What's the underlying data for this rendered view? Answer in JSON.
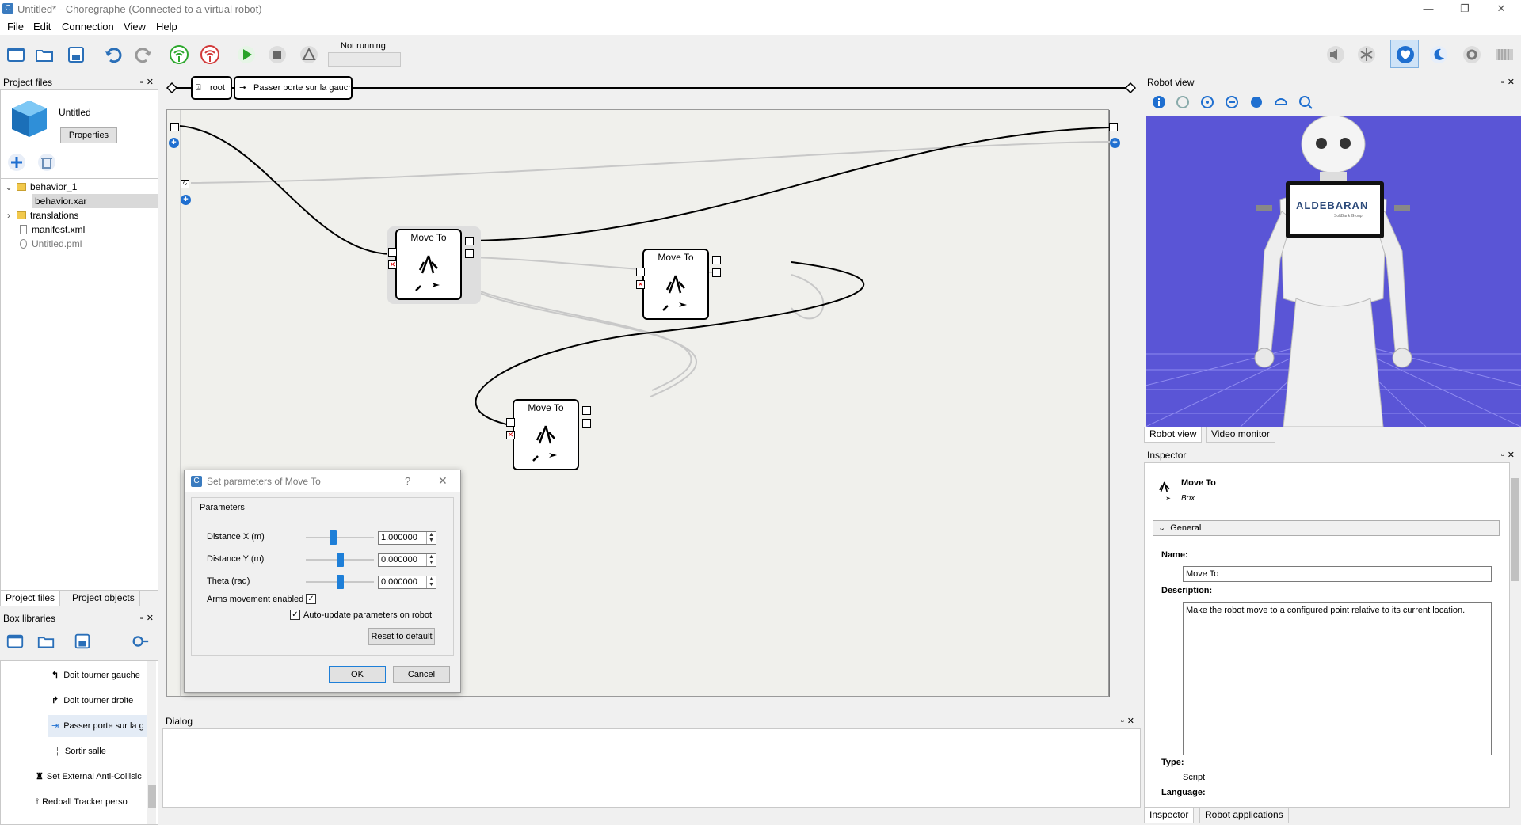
{
  "window": {
    "title": "Untitled* - Choregraphe (Connected to a virtual robot)",
    "app_icon": "C",
    "min": "—",
    "max": "❐",
    "close": "✕"
  },
  "menu": {
    "items": [
      "File",
      "Edit",
      "Connection",
      "View",
      "Help"
    ]
  },
  "toolbar": {
    "status": "Not running"
  },
  "project_files": {
    "header": "Project files",
    "project_name": "Untitled",
    "properties_button": "Properties",
    "tree": [
      {
        "label": "behavior_1",
        "type": "folder",
        "expander": "⌄"
      },
      {
        "label": "behavior.xar",
        "type": "item"
      },
      {
        "label": "translations",
        "type": "folder",
        "expander": "›"
      },
      {
        "label": "manifest.xml",
        "type": "file"
      },
      {
        "label": "Untitled.pml",
        "type": "file"
      }
    ],
    "tabs": [
      "Project files",
      "Project objects"
    ]
  },
  "box_libraries": {
    "header": "Box libraries",
    "items": [
      "Doit tourner gauche",
      "Doit tourner droite",
      "Passer porte sur la g",
      "Sortir salle",
      "Set External Anti-Collisic",
      "Redball Tracker perso"
    ]
  },
  "breadcrumb": {
    "root": "root",
    "current": "Passer porte sur la gauche"
  },
  "flow": {
    "boxes": [
      {
        "title": "Move To"
      },
      {
        "title": "Move To"
      },
      {
        "title": "Move To"
      }
    ]
  },
  "dialog_panel": {
    "header": "Dialog"
  },
  "robot_view": {
    "header": "Robot view",
    "tabs": [
      "Robot view",
      "Video monitor"
    ],
    "screen_text": "ALDEBARAN",
    "screen_subtext": "SoftBank Group"
  },
  "inspector": {
    "header": "Inspector",
    "box_name": "Move To",
    "box_kind": "Box",
    "section": "General",
    "name_label": "Name:",
    "name_value": "Move To",
    "description_label": "Description:",
    "description_value": "Make the robot move to a configured point relative to its current location.",
    "type_label": "Type:",
    "type_value": "Script",
    "language_label": "Language:",
    "tabs": [
      "Inspector",
      "Robot applications"
    ]
  },
  "param_dialog": {
    "title": "Set parameters of Move To",
    "help": "?",
    "close": "✕",
    "group": "Parameters",
    "rows": [
      {
        "label": "Distance X (m)",
        "value": "1.000000"
      },
      {
        "label": "Distance Y (m)",
        "value": "0.000000"
      },
      {
        "label": "Theta (rad)",
        "value": "0.000000"
      }
    ],
    "slider_levels": [
      0.4,
      0.5,
      0.5
    ],
    "arms_label": "Arms movement enabled",
    "auto_update_label": "Auto-update parameters on robot",
    "reset_button": "Reset to default",
    "ok_button": "OK",
    "cancel_button": "Cancel"
  },
  "colors": {
    "accent": "#1e7fd8",
    "robot_bg": "#5a55d6",
    "canvas": "#f0f0ec"
  }
}
